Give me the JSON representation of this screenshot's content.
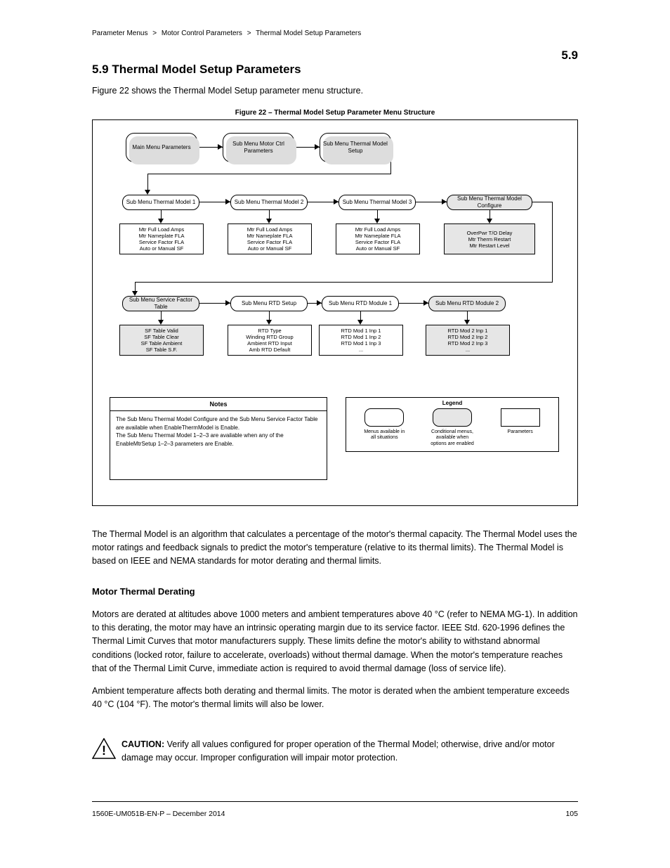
{
  "breadcrumb": {
    "items": [
      "Parameter Menus",
      "Motor Control Parameters",
      "Thermal Model Setup Parameters"
    ],
    "sep": ">"
  },
  "section": {
    "number": "5.9",
    "title": "5.9  Thermal Model Setup Parameters"
  },
  "intro": "Figure 22 shows the Thermal Model Setup parameter menu structure.",
  "figure_title": "Figure 22 – Thermal Model Setup Parameter Menu Structure",
  "diagram": {
    "top_menus": [
      "Main Menu Parameters",
      "Sub Menu Motor Ctrl Parameters",
      "Sub Menu Thermal Model Setup"
    ],
    "row1": {
      "sub": [
        "Sub Menu Thermal Model 1",
        "Sub Menu Thermal Model 2",
        "Sub Menu Thermal Model 3",
        "Sub Menu Thermal Model Configure"
      ],
      "param": [
        "Mtr Full Load Amps\nMtr Nameplate FLA\nService Factor FLA\nAuto or Manual SF",
        "Mtr Full Load Amps\nMtr Nameplate FLA\nService Factor FLA\nAuto or Manual SF",
        "Mtr Full Load Amps\nMtr Nameplate FLA\nService Factor FLA\nAuto or Manual SF",
        "OverPwr T/O Delay\nMtr Therm Restart\nMtr Restart Level"
      ],
      "grey": [
        false,
        false,
        false,
        true
      ],
      "sub_grey": [
        false,
        false,
        false,
        true
      ]
    },
    "row2": {
      "sub": [
        "Sub Menu Service Factor Table",
        "Sub Menu RTD Setup",
        "Sub Menu RTD Module 1",
        "Sub Menu RTD Module 2"
      ],
      "param": [
        "SF Table Valid\nSF Table Clear\nSF Table Ambient\nSF Table S.F.",
        "RTD Type\nWinding RTD Group\nAmbient RTD Input\nAmb RTD Default",
        "RTD Mod 1 Inp 1\nRTD Mod 1 Inp 2\nRTD Mod 1 Inp 3\n...",
        "RTD Mod 2 Inp 1\nRTD Mod 2 Inp 2\nRTD Mod 2 Inp 3\n..."
      ],
      "grey": [
        true,
        false,
        false,
        true
      ],
      "sub_grey": [
        true,
        false,
        false,
        true
      ]
    }
  },
  "notes": {
    "head": "Notes",
    "body": "The Sub Menu Thermal Model Configure and the Sub Menu Service Factor Table are available when EnableThermModel is Enable.\nThe Sub Menu Thermal Model 1–2–3 are available when any of the EnableMtrSetup 1–2–3 parameters are Enable."
  },
  "legend": {
    "title": "Legend",
    "items": [
      {
        "label": "Menus available in\nall situations"
      },
      {
        "label": "Conditional menus,\navailable when\noptions are enabled"
      },
      {
        "label": "Parameters"
      }
    ]
  },
  "para_after_fig": "The Thermal Model is an algorithm that calculates a percentage of the motor's thermal capacity. The Thermal Model uses the motor ratings and feedback signals to predict the motor's temperature (relative to its thermal limits). The Thermal Model is based on IEEE and NEMA standards for motor derating and thermal limits.",
  "mtd": {
    "head": "Motor Thermal Derating",
    "body": "Motors are derated at altitudes above 1000 meters and ambient temperatures above 40 °C (refer to NEMA MG-1). In addition to this derating, the motor may have an intrinsic operating margin due to its service factor. IEEE Std. 620-1996 defines the Thermal Limit Curves that motor manufacturers supply. These limits define the motor's ability to withstand abnormal conditions (locked rotor, failure to accelerate, overloads) without thermal damage. When the motor's temperature reaches that of the Thermal Limit Curve, immediate action is required to avoid thermal damage (loss of service life).",
    "body2": "Ambient temperature affects both derating and thermal limits. The motor is derated when the ambient temperature exceeds 40 °C (104 °F).  The motor's thermal limits will also be lower."
  },
  "caution": {
    "label": "CAUTION:",
    "text": "Verify all values configured for proper operation of the Thermal Model; otherwise, drive and/or motor damage may occur. Improper configuration will impair motor protection."
  },
  "footer": {
    "left": "1560E-UM051B-EN-P – December 2014",
    "right": "105"
  }
}
